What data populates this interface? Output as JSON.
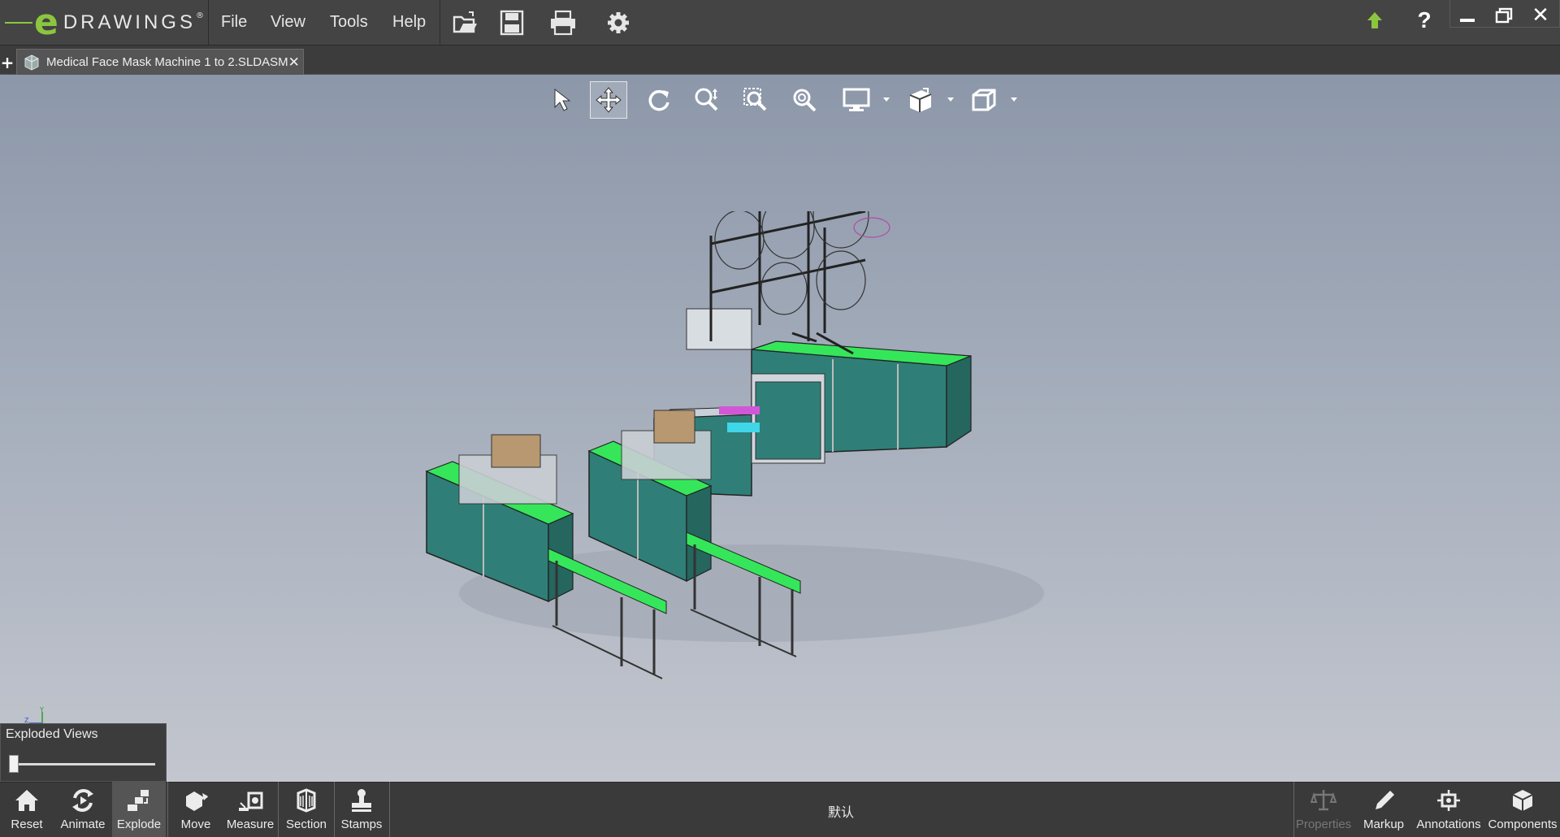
{
  "app": {
    "logo_letter": "e",
    "logo_word": "DRAWINGS",
    "logo_mark": "®"
  },
  "menu": {
    "file": "File",
    "view": "View",
    "tools": "Tools",
    "help": "Help"
  },
  "toolbar": {
    "icons": [
      "open-icon",
      "save-icon",
      "print-icon",
      "settings-icon"
    ]
  },
  "window_controls": [
    "upgrade-icon",
    "help-icon",
    "minimize-icon",
    "restore-icon",
    "close-icon"
  ],
  "tab": {
    "new_tab": "+",
    "document_name": "Medical Face Mask Machine 1 to 2.SLDASM",
    "close": "✕"
  },
  "view_toolbar": {
    "tools": [
      "select",
      "pan",
      "rotate",
      "zoom",
      "zoom-to-area",
      "zoom-to-fit",
      "display-style",
      "standard-views",
      "view-orientation"
    ],
    "active_tool": "pan"
  },
  "triad": {
    "y_axis": "Y",
    "x_axis": "Z"
  },
  "exploded_views": {
    "title": "Exploded Views",
    "slider_value": 0
  },
  "bottom_toolbar": {
    "items": [
      {
        "label": "Reset",
        "icon": "home-icon"
      },
      {
        "label": "Animate",
        "icon": "animate-icon"
      },
      {
        "label": "Explode",
        "icon": "explode-icon",
        "active": true
      },
      {
        "label": "Move",
        "icon": "move-icon"
      },
      {
        "label": "Measure",
        "icon": "measure-icon"
      },
      {
        "label": "Section",
        "icon": "section-icon"
      },
      {
        "label": "Stamps",
        "icon": "stamps-icon"
      }
    ],
    "configuration": "默认",
    "right_items": [
      {
        "label": "Properties",
        "icon": "properties-icon",
        "disabled": true
      },
      {
        "label": "Markup",
        "icon": "markup-icon"
      },
      {
        "label": "Annotations",
        "icon": "annotations-icon"
      },
      {
        "label": "Components",
        "icon": "components-icon"
      }
    ]
  },
  "colors": {
    "accent_green": "#8cc63f",
    "machine_top_green": "#35e65a",
    "machine_panel_teal": "#2f7f78",
    "viewport_top": "#8c97a9",
    "viewport_bottom": "#c3c6ce"
  }
}
